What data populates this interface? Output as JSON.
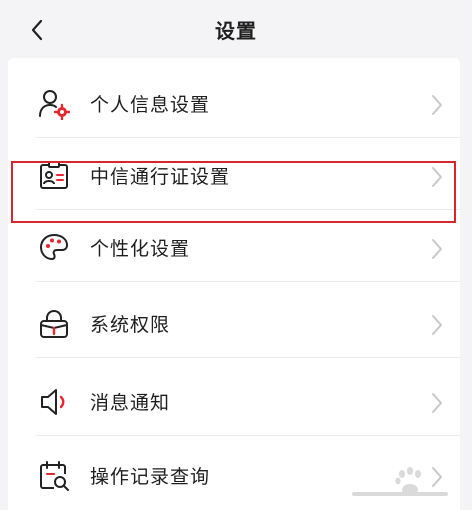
{
  "header": {
    "title": "设置",
    "back_icon": "chevron-left-icon"
  },
  "menu": {
    "items": [
      {
        "label": "个人信息设置",
        "icon": "user-gear-icon"
      },
      {
        "label": "中信通行证设置",
        "icon": "id-card-icon"
      },
      {
        "label": "个性化设置",
        "icon": "palette-icon",
        "highlighted": true
      },
      {
        "label": "系统权限",
        "icon": "lock-icon"
      },
      {
        "label": "消息通知",
        "icon": "speaker-icon"
      },
      {
        "label": "操作记录查询",
        "icon": "calendar-search-icon"
      }
    ]
  },
  "colors": {
    "background": "#f4f4f6",
    "card": "#ffffff",
    "accent": "#e8262f",
    "highlight_border": "#d9262c",
    "chevron": "#c8c8c8"
  }
}
